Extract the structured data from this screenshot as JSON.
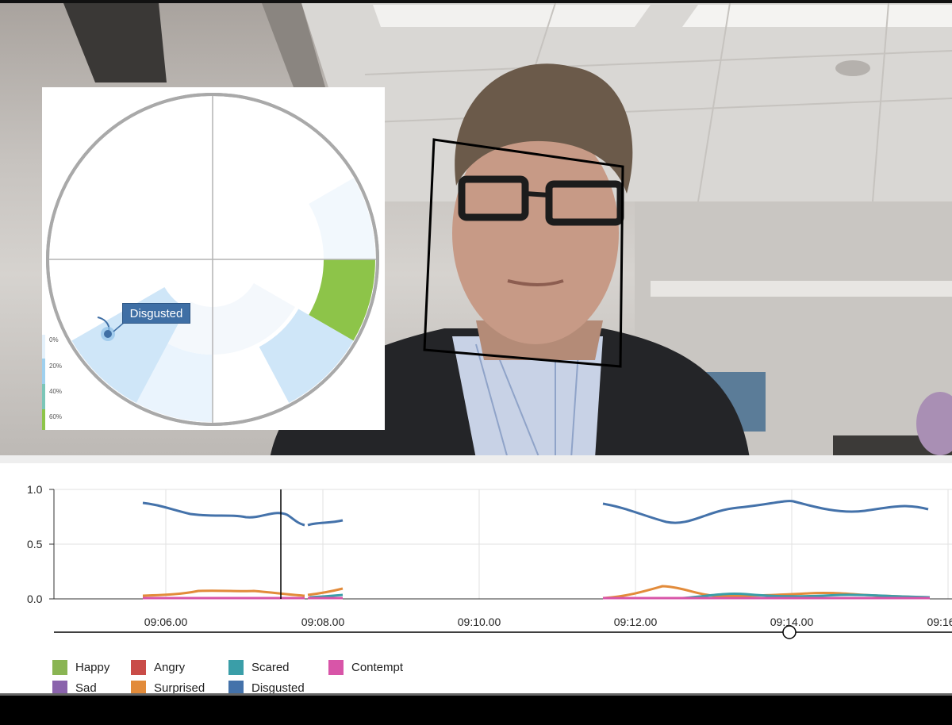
{
  "radial": {
    "tooltip": "Disgusted",
    "scale": [
      "0%",
      "20%",
      "40%",
      "60%"
    ]
  },
  "timeline": {
    "y_ticks": [
      "1.0",
      "0.5",
      "0.0"
    ],
    "x_ticks": [
      "09:06.00",
      "09:08.00",
      "09:10.00",
      "09:12.00",
      "09:14.00",
      "09:16"
    ]
  },
  "legend": [
    {
      "label": "Happy",
      "color": "#8ab553"
    },
    {
      "label": "Angry",
      "color": "#c94c48"
    },
    {
      "label": "Scared",
      "color": "#3a9ea8"
    },
    {
      "label": "Contempt",
      "color": "#d855a8"
    },
    {
      "label": "Sad",
      "color": "#8a63ac"
    },
    {
      "label": "Surprised",
      "color": "#e28b3a"
    },
    {
      "label": "Disgusted",
      "color": "#4472aa"
    }
  ],
  "colors": {
    "disgusted": "#4472aa",
    "surprised": "#e28b3a",
    "scared": "#3a9ea8",
    "contempt": "#d855a8",
    "happy_segment": "#8dc449",
    "light_segment": "#cfe6f8"
  }
}
